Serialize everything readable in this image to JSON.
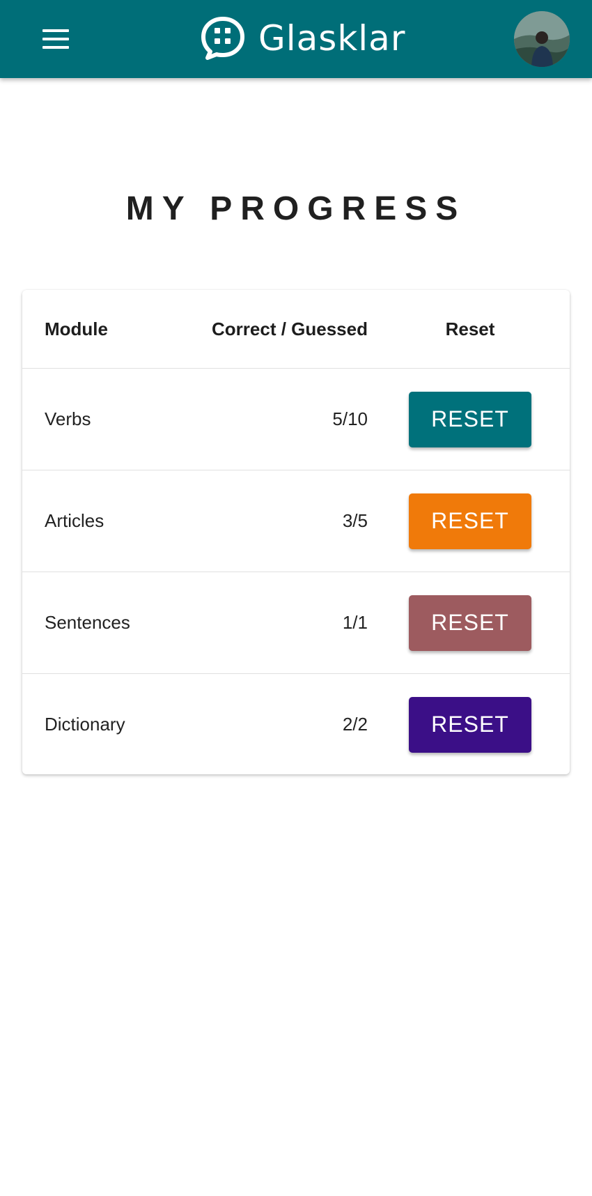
{
  "header": {
    "app_name": "Glasklar",
    "menu_icon": "hamburger-menu-icon",
    "logo_icon": "chat-bubble-icon",
    "avatar": "user-avatar",
    "background_color": "#006e78"
  },
  "page": {
    "title": "MY PROGRESS"
  },
  "table": {
    "columns": [
      "Module",
      "Correct / Guessed",
      "Reset"
    ],
    "rows": [
      {
        "module": "Verbs",
        "score": "5/10",
        "reset_label": "RESET",
        "button_color": "#00717b"
      },
      {
        "module": "Articles",
        "score": "3/5",
        "reset_label": "RESET",
        "button_color": "#f07a0a"
      },
      {
        "module": "Sentences",
        "score": "1/1",
        "reset_label": "RESET",
        "button_color": "#9d5b5f"
      },
      {
        "module": "Dictionary",
        "score": "2/2",
        "reset_label": "RESET",
        "button_color": "#3b0f87"
      }
    ]
  }
}
